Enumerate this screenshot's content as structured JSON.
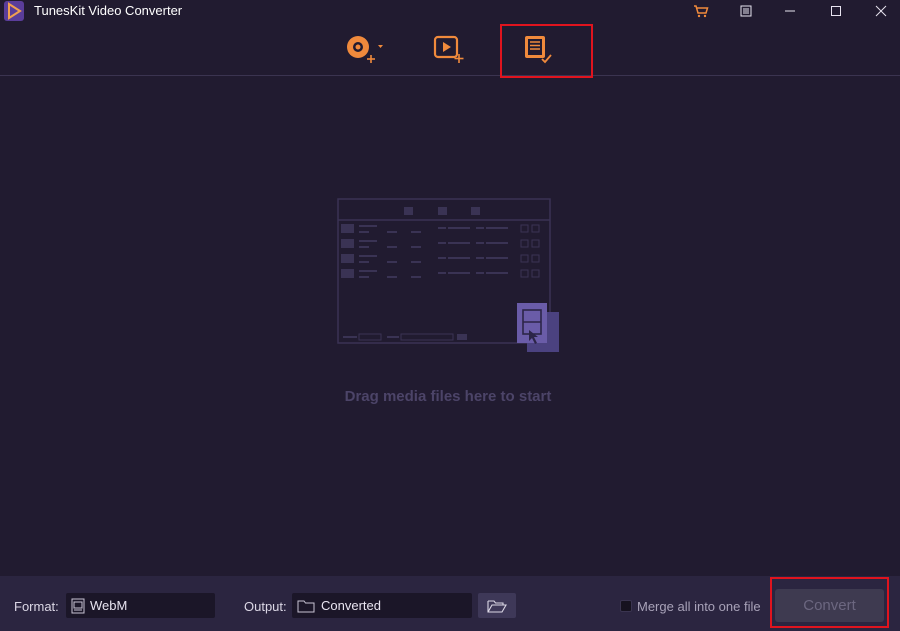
{
  "app": {
    "title": "TunesKit Video Converter"
  },
  "titlebar": {
    "cart_icon": "cart-icon",
    "menu_icon": "menu-icon",
    "minimize_icon": "minimize-icon",
    "maximize_icon": "maximize-icon",
    "close_icon": "close-icon"
  },
  "toolbar": {
    "items": [
      {
        "icon": "add-dvd-icon"
      },
      {
        "icon": "add-video-icon"
      },
      {
        "icon": "converted-history-icon"
      }
    ]
  },
  "main": {
    "drop_hint": "Drag media files here to start"
  },
  "bottom": {
    "format_label": "Format:",
    "format_value": "WebM",
    "output_label": "Output:",
    "output_value": "Converted",
    "merge_label": "Merge all into one file",
    "merge_checked": false,
    "convert_label": "Convert"
  },
  "colors": {
    "accent": "#f08a3c",
    "background": "#211b30",
    "bottom_bar": "#2b2540",
    "highlight": "#e0141e"
  }
}
